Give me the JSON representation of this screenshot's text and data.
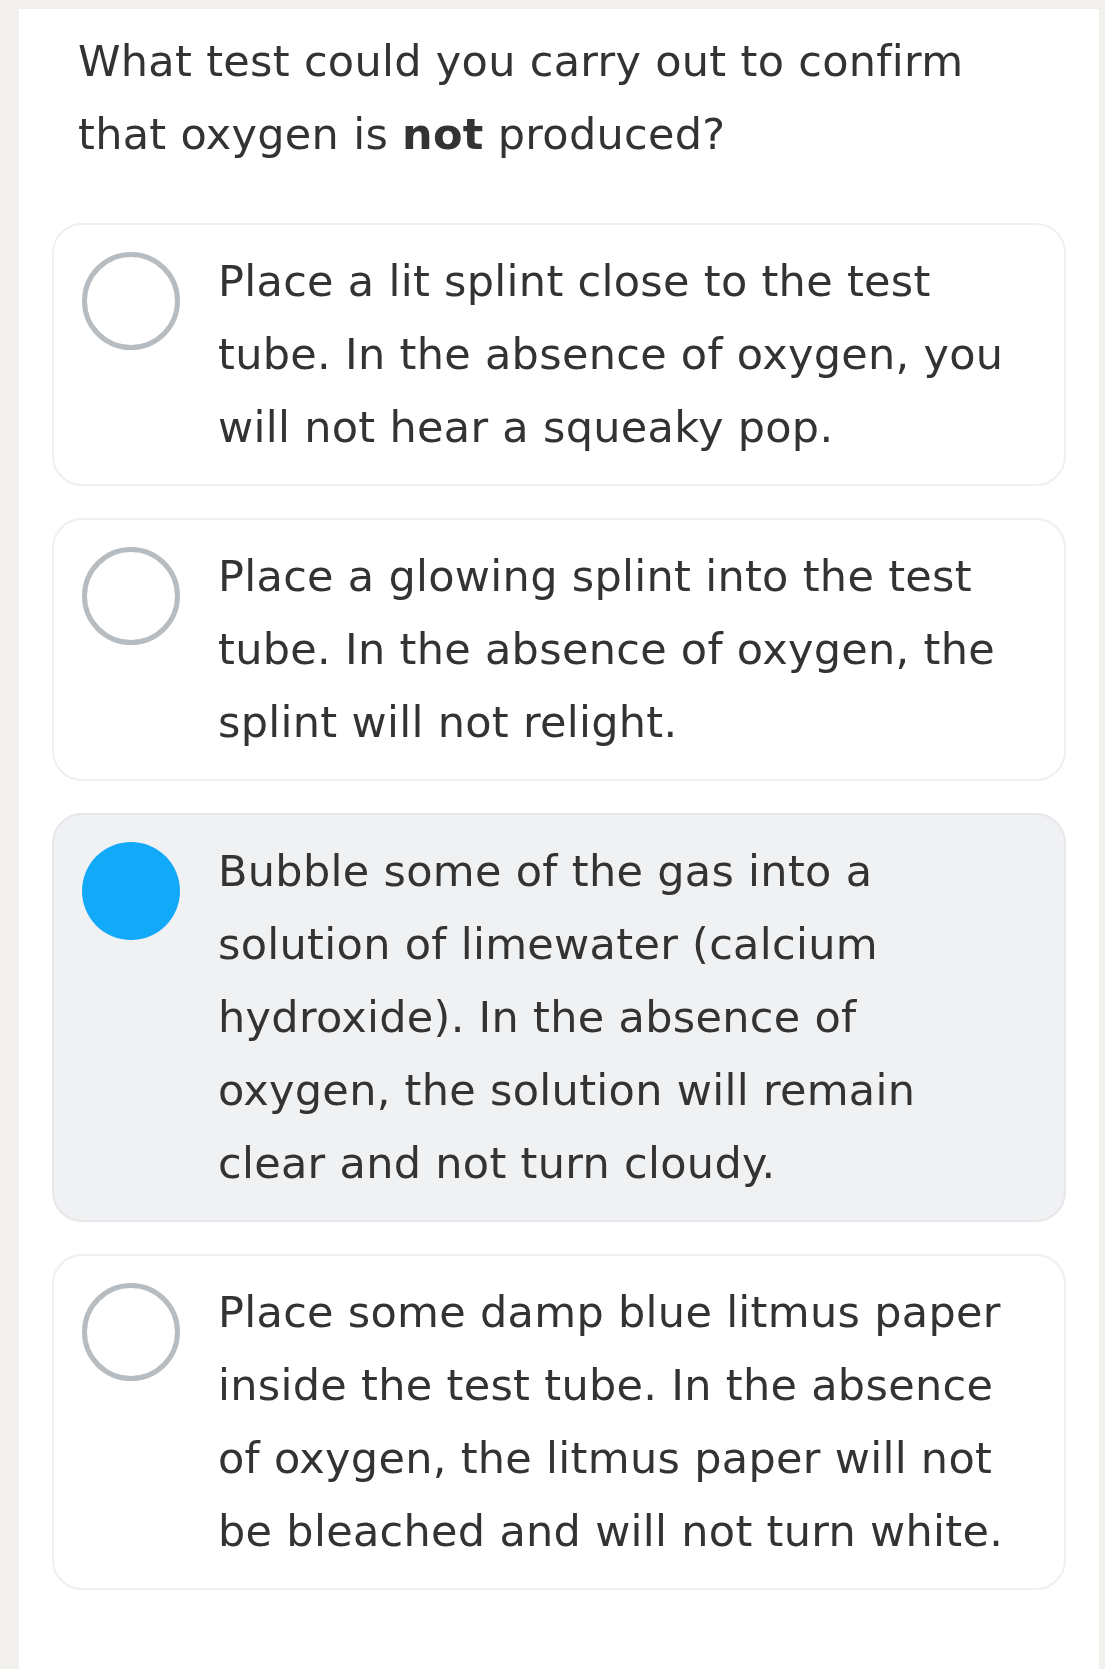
{
  "question": "What test could you carry out to confirm that oxygen is **not** produced?",
  "options": [
    {
      "text": "Place a lit splint close to the test tube. In the absence of oxygen, you will not hear a squeaky pop.",
      "selected": false
    },
    {
      "text": "Place a glowing splint into the test tube. In the absence of oxygen, the splint will not relight.",
      "selected": false
    },
    {
      "text": "Bubble some of the gas into a solution of limewater (calcium hydroxide). In the absence of oxygen, the solution will remain clear and not turn cloudy.",
      "selected": true
    },
    {
      "text": "Place some damp blue litmus paper inside the test tube. In the absence of oxygen, the litmus paper will not be bleached and will not turn white.",
      "selected": false
    }
  ]
}
